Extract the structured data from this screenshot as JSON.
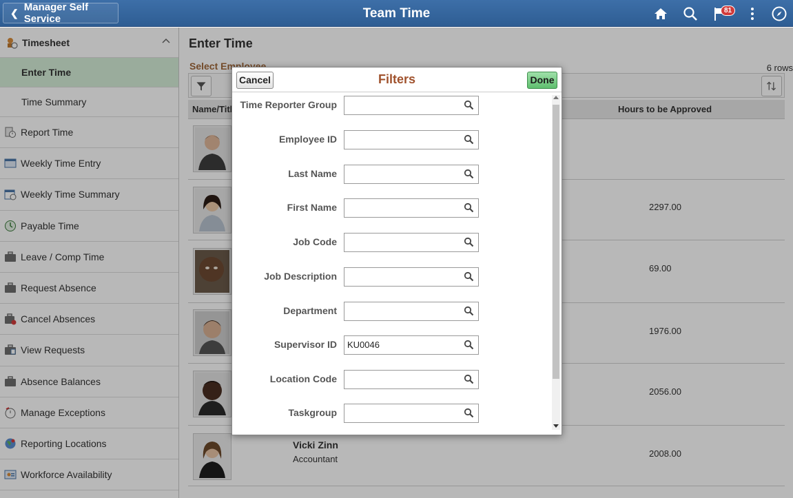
{
  "header": {
    "back_label": "Manager Self Service",
    "title": "Team Time",
    "notification_count": "81",
    "icons": [
      "home-icon",
      "search-icon",
      "flag-icon",
      "more-icon",
      "navbar-icon"
    ]
  },
  "sidebar": {
    "section": "Timesheet",
    "sub_items": [
      {
        "label": "Enter Time",
        "active": true
      },
      {
        "label": "Time Summary",
        "active": false
      }
    ],
    "items": [
      {
        "label": "Report Time",
        "icon": "report-time-icon"
      },
      {
        "label": "Weekly Time Entry",
        "icon": "weekly-time-entry-icon"
      },
      {
        "label": "Weekly Time Summary",
        "icon": "calendar-icon"
      },
      {
        "label": "Payable Time",
        "icon": "payable-time-icon"
      },
      {
        "label": "Leave / Comp Time",
        "icon": "briefcase-icon"
      },
      {
        "label": "Request Absence",
        "icon": "briefcase-icon"
      },
      {
        "label": "Cancel Absences",
        "icon": "briefcase-cancel-icon"
      },
      {
        "label": "View Requests",
        "icon": "briefcase-list-icon"
      },
      {
        "label": "Absence Balances",
        "icon": "briefcase-balance-icon"
      },
      {
        "label": "Manage Exceptions",
        "icon": "exceptions-icon"
      },
      {
        "label": "Reporting Locations",
        "icon": "globe-icon"
      },
      {
        "label": "Workforce Availability",
        "icon": "workforce-icon"
      }
    ]
  },
  "main": {
    "title": "Enter Time",
    "select_employee": "Select Employee",
    "row_count": "6 rows",
    "columns": {
      "name": "Name/Title",
      "hours": "Hours to be Approved"
    },
    "rows": [
      {
        "name": "",
        "title": "",
        "hours": ""
      },
      {
        "name": "",
        "title": "",
        "hours": "2297.00"
      },
      {
        "name": "",
        "title": "",
        "hours": "69.00"
      },
      {
        "name": "",
        "title": "",
        "hours": "1976.00"
      },
      {
        "name": "",
        "title": "",
        "hours": "2056.00"
      },
      {
        "name": "Vicki Zinn",
        "title": "Accountant",
        "hours": "2008.00"
      }
    ]
  },
  "modal": {
    "title": "Filters",
    "cancel_label": "Cancel",
    "done_label": "Done",
    "fields": [
      {
        "label": "Time Reporter Group",
        "value": ""
      },
      {
        "label": "Employee ID",
        "value": ""
      },
      {
        "label": "Last Name",
        "value": ""
      },
      {
        "label": "First Name",
        "value": ""
      },
      {
        "label": "Job Code",
        "value": ""
      },
      {
        "label": "Job Description",
        "value": ""
      },
      {
        "label": "Department",
        "value": ""
      },
      {
        "label": "Supervisor ID",
        "value": "KU0046"
      },
      {
        "label": "Location Code",
        "value": ""
      },
      {
        "label": "Taskgroup",
        "value": ""
      }
    ]
  },
  "colors": {
    "header_bg": "#2e5d93",
    "active_item_bg": "#d6efd9",
    "modal_title": "#a0522d",
    "done_button": "#5fbf6e"
  }
}
